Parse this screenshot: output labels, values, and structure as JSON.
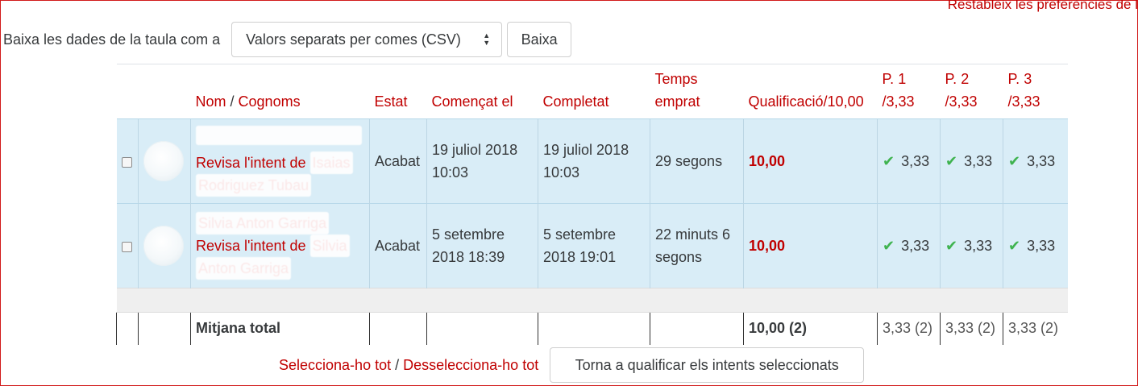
{
  "reset_preferences": "Restableix les preferències de l",
  "download": {
    "label": "Baixa les dades de la taula com a",
    "format_selected": "Valors separats per comes (CSV)",
    "button": "Baixa"
  },
  "table": {
    "headers": {
      "name": "Nom",
      "name_sep": " / ",
      "surname": "Cognoms",
      "state": "Estat",
      "started": "Començat el",
      "completed": "Completat",
      "time_taken_1": "Temps",
      "time_taken_2": "emprat",
      "grade": "Qualificació/10,00",
      "q1_1": "P. 1",
      "q1_2": "/3,33",
      "q2_1": "P. 2",
      "q2_2": "/3,33",
      "q3_1": "P. 3",
      "q3_2": "/3,33"
    },
    "rows": [
      {
        "name_line": "",
        "review_text": "Revisa l'intent de",
        "review_name_1": "Isaias",
        "review_name_2": "Rodriguez Tubau",
        "state": "Acabat",
        "started_1": "19 juliol 2018",
        "started_2": "10:03",
        "completed_1": "19 juliol 2018",
        "completed_2": "10:03",
        "time_1": "29 segons",
        "time_2": "",
        "grade": "10,00",
        "q1": "3,33",
        "q2": "3,33",
        "q3": "3,33"
      },
      {
        "name_line": "Silvia Anton Garriga",
        "review_text": "Revisa l'intent de",
        "review_name_1": "Silvia",
        "review_name_2": "Anton Garriga",
        "state": "Acabat",
        "started_1": "5 setembre",
        "started_2": "2018 18:39",
        "completed_1": "5 setembre",
        "completed_2": "2018 19:01",
        "time_1": "22 minuts 6",
        "time_2": "segons",
        "grade": "10,00",
        "q1": "3,33",
        "q2": "3,33",
        "q3": "3,33"
      }
    ],
    "total": {
      "label": "Mitjana total",
      "grade": "10,00 (2)",
      "q1": "3,33 (2)",
      "q2": "3,33 (2)",
      "q3": "3,33 (2)"
    }
  },
  "bottom": {
    "select_all": "Selecciona-ho tot",
    "separator": "/",
    "deselect_all": "Desselecciona-ho tot",
    "regrade_button": "Torna a qualificar els intents seleccionats"
  },
  "colors": {
    "link": "#c00000",
    "row_highlight": "#d9edf7",
    "tick": "#3fb34f"
  }
}
